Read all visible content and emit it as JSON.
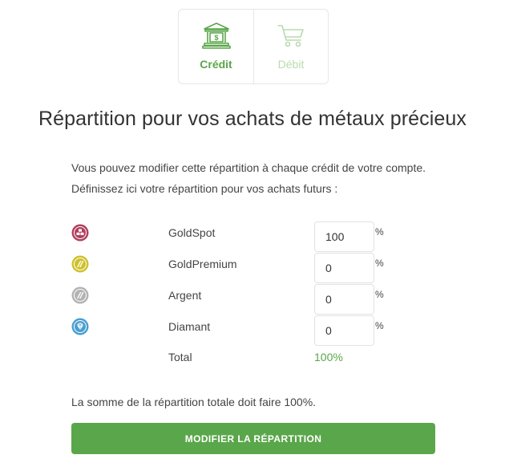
{
  "tabs": [
    {
      "label": "Crédit",
      "icon": "bank-icon",
      "active": true
    },
    {
      "label": "Débit",
      "icon": "cart-icon",
      "active": false
    }
  ],
  "title": "Répartition pour vos achats de métaux précieux",
  "intro": {
    "line1": "Vous pouvez modifier cette répartition à chaque crédit de votre compte.",
    "line2": "Définissez ici votre répartition pour vos achats futurs :"
  },
  "allocations": [
    {
      "name": "GoldSpot",
      "value": "100",
      "unit": "%",
      "icon": "goldspot-icon",
      "color": "#b0405e"
    },
    {
      "name": "GoldPremium",
      "value": "0",
      "unit": "%",
      "icon": "goldpremium-icon",
      "color": "#cfc12c"
    },
    {
      "name": "Argent",
      "value": "0",
      "unit": "%",
      "icon": "argent-icon",
      "color": "#b3b3b3"
    },
    {
      "name": "Diamant",
      "value": "0",
      "unit": "%",
      "icon": "diamant-icon",
      "color": "#4a9fd1"
    }
  ],
  "total": {
    "label": "Total",
    "value": "100%"
  },
  "note": "La somme de la répartition totale doit faire 100%.",
  "submit_label": "MODIFIER LA RÉPARTITION",
  "colors": {
    "accent": "#5aa64a",
    "accent_light": "#b8dbae"
  }
}
